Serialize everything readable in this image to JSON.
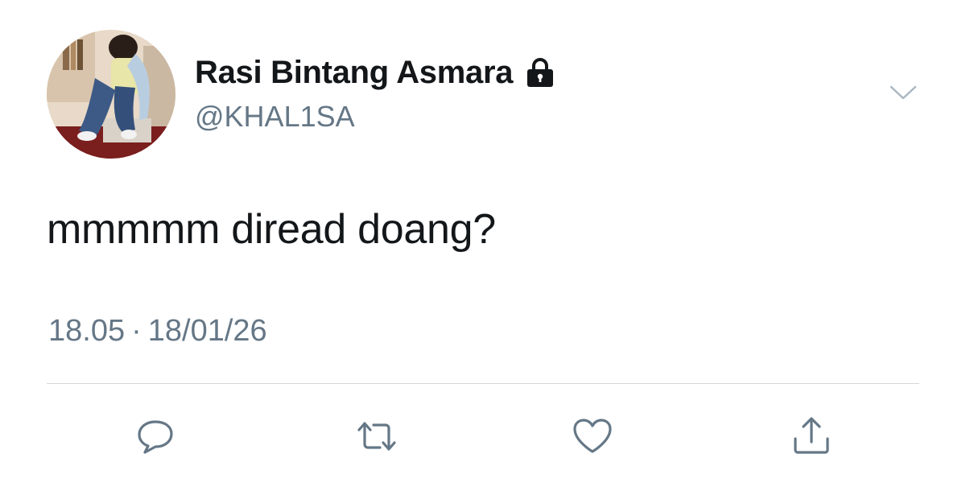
{
  "tweet": {
    "display_name": "Rasi Bintang Asmara",
    "handle": "@KHAL1SA",
    "text": "mmmmm diread doang?",
    "time": "18.05",
    "separator": "·",
    "date": "18/01/26"
  },
  "icons": {
    "avatar": "avatar-photo",
    "lock": "lock-icon",
    "menu": "chevron-down-icon",
    "reply": "reply-icon",
    "retweet": "retweet-icon",
    "like": "heart-icon",
    "share": "share-icon"
  },
  "colors": {
    "text_primary": "#14171a",
    "text_secondary": "#657786",
    "divider": "#d4d8dc",
    "icon": "#657786"
  }
}
